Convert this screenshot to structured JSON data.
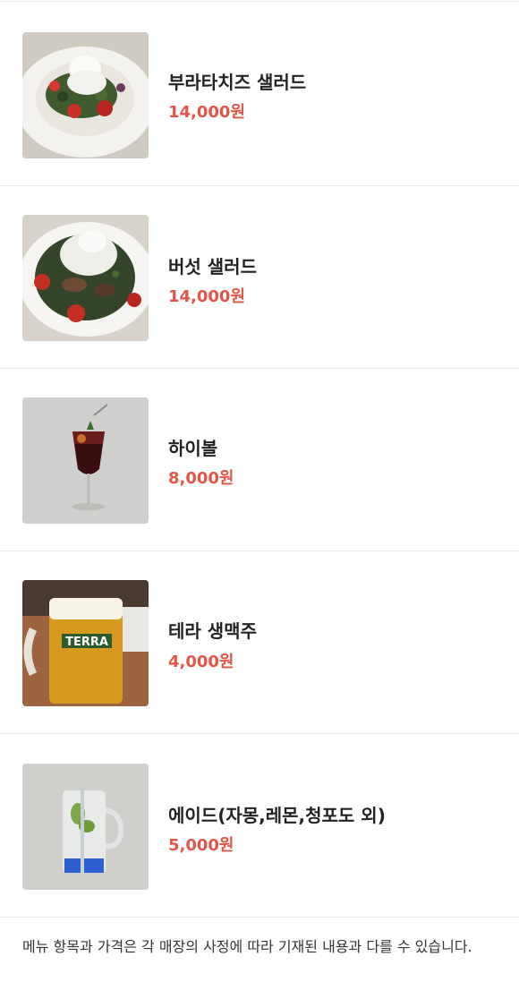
{
  "menu_items": [
    {
      "name": "부라타치즈 샐러드",
      "price": "14,000원",
      "image": "burrata-salad-photo"
    },
    {
      "name": "버섯 샐러드",
      "price": "14,000원",
      "image": "mushroom-salad-photo"
    },
    {
      "name": "하이볼",
      "price": "8,000원",
      "image": "highball-photo"
    },
    {
      "name": "테라 생맥주",
      "price": "4,000원",
      "image": "terra-draft-beer-photo",
      "image_label": "TERRA"
    },
    {
      "name": "에이드(자몽,레몬,청포도 외)",
      "price": "5,000원",
      "image": "ade-photo"
    }
  ],
  "notice": "메뉴 항목과 가격은 각 매장의 사정에 따라 기재된 내용과 다를 수 있습니다.",
  "colors": {
    "price": "#e2564a",
    "divider": "#ececec",
    "text": "#222222"
  }
}
